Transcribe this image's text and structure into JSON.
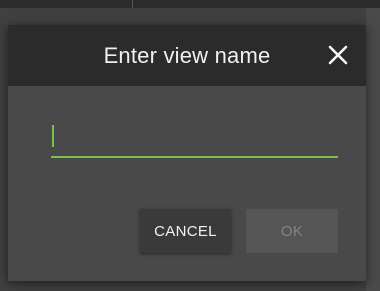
{
  "dialog": {
    "title": "Enter view name",
    "close_icon": "close-icon"
  },
  "view_name_input": {
    "value": "",
    "placeholder": ""
  },
  "buttons": {
    "cancel_label": "CANCEL",
    "ok_label": "OK",
    "ok_enabled": false
  },
  "colors": {
    "accent": "#79c14f",
    "header_bg": "#2b2b2b",
    "dialog_bg": "#494949",
    "title_text": "#f0f0f0",
    "ok_disabled_text": "#838383"
  }
}
